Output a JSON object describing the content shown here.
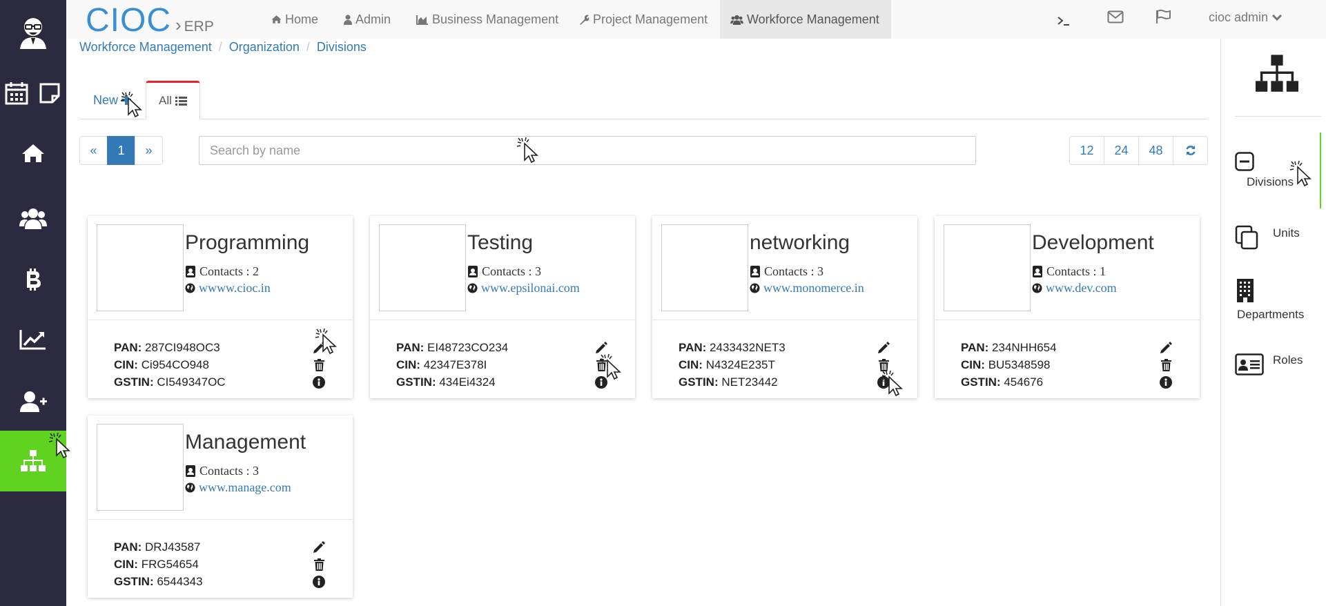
{
  "brand": {
    "logo": "CIOC",
    "separator": "›",
    "product": "ERP"
  },
  "nav": {
    "items": [
      {
        "label": "Home",
        "icon": "home-icon"
      },
      {
        "label": "Admin",
        "icon": "user-icon"
      },
      {
        "label": "Business Management",
        "icon": "area-chart-icon"
      },
      {
        "label": "Project Management",
        "icon": "wrench-icon"
      },
      {
        "label": "Workforce Management",
        "icon": "users-icon",
        "active": true
      }
    ],
    "terminal_icon": "terminal-icon",
    "mail_icon": "envelope-icon",
    "flag_icon": "flag-icon",
    "user": "cioc admin"
  },
  "breadcrumb": [
    "Workforce Management",
    "Organization",
    "Divisions"
  ],
  "tabs": {
    "new_label": "New",
    "all_label": "All"
  },
  "pager": {
    "prev": "«",
    "page": "1",
    "next": "»"
  },
  "search": {
    "placeholder": "Search by name",
    "value": ""
  },
  "page_size": {
    "options": [
      "12",
      "24",
      "48"
    ],
    "selected": "12"
  },
  "cards": [
    {
      "name": "Programming",
      "contacts": "Contacts : 2",
      "website": "wwww.cioc.in",
      "pan": "287CI948OC3",
      "cin": "Ci954CO948",
      "gstin": "CI549347OC"
    },
    {
      "name": "Testing",
      "contacts": "Contacts : 3",
      "website": "www.epsilonai.com",
      "pan": "EI48723CO234",
      "cin": "42347E378I",
      "gstin": "434Ei4324"
    },
    {
      "name": "networking",
      "contacts": "Contacts : 3",
      "website": "www.monomerce.in",
      "pan": "2433432NET3",
      "cin": "N4324E235T",
      "gstin": "NET23442"
    },
    {
      "name": "Development",
      "contacts": "Contacts : 1",
      "website": "www.dev.com",
      "pan": "234NHH654",
      "cin": "BU5348598",
      "gstin": "454676"
    },
    {
      "name": "Management",
      "contacts": "Contacts : 3",
      "website": "www.manage.com",
      "pan": "DRJ43587",
      "cin": "FRG54654",
      "gstin": "6544343"
    }
  ],
  "field_labels": {
    "pan": "PAN:",
    "cin": "CIN:",
    "gstin": "GSTIN:"
  },
  "right_sidebar": {
    "items": [
      {
        "label": "Divisions",
        "icon": "minus-square-icon",
        "active": true
      },
      {
        "label": "Units",
        "icon": "copy-icon"
      },
      {
        "label": "Departments",
        "icon": "building-icon"
      },
      {
        "label": "Roles",
        "icon": "id-card-icon"
      }
    ]
  },
  "left_sidebar": {
    "items": [
      "avatar",
      "calendar-icon",
      "sticky-note-icon",
      "home-icon",
      "users-icon",
      "bitcoin-icon",
      "line-chart-icon",
      "user-plus-icon",
      "sitemap-icon"
    ],
    "active": "sitemap-icon"
  },
  "colors": {
    "sidebar_bg": "#2b2b3f",
    "accent_green": "#5fd31f",
    "link_blue": "#337ab7",
    "tab_red": "#e8222a"
  }
}
